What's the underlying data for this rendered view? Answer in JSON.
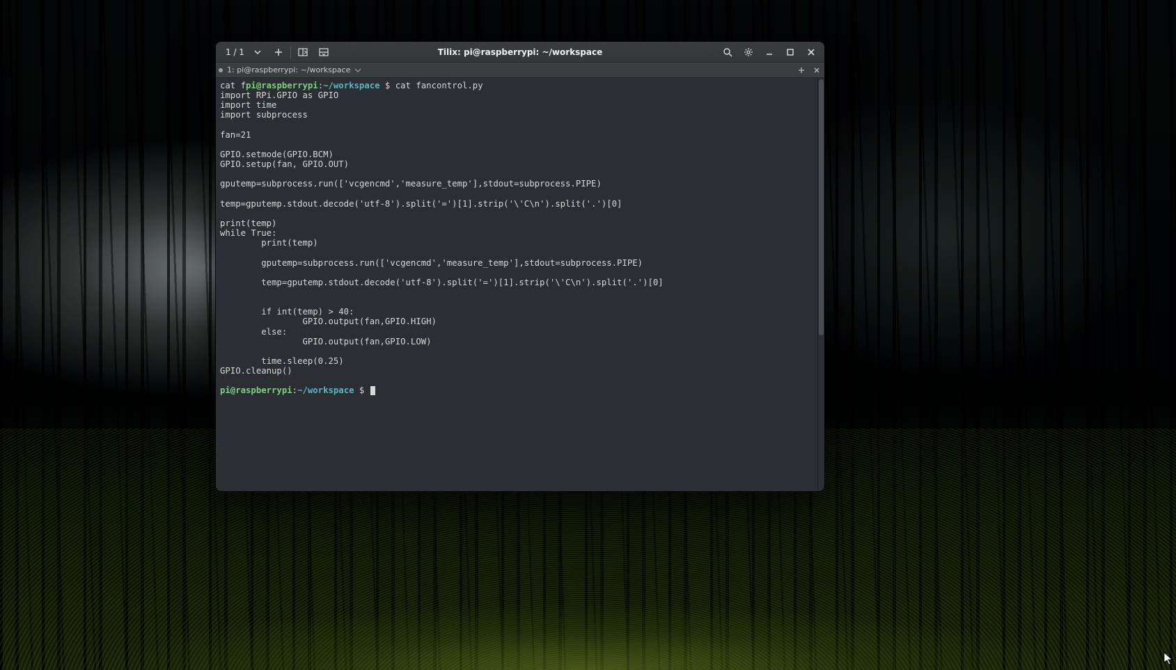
{
  "window": {
    "title": "Tilix: pi@raspberrypi: ~/workspace",
    "counter": "1 / 1"
  },
  "tab": {
    "label": "1: pi@raspberrypi: ~/workspace"
  },
  "prompt": {
    "user_host": "pi@raspberrypi",
    "sep": ":",
    "path": "~/workspace",
    "dollar": " $ "
  },
  "terminal": {
    "line0_prefix": "cat f",
    "line0_cmd": "cat fancontrol.py",
    "body": "import RPi.GPIO as GPIO\nimport time\nimport subprocess\n\nfan=21\n\nGPIO.setmode(GPIO.BCM)\nGPIO.setup(fan, GPIO.OUT)\n\ngputemp=subprocess.run(['vcgencmd','measure_temp'],stdout=subprocess.PIPE)\n\ntemp=gputemp.stdout.decode('utf-8').split('=')[1].strip('\\'C\\n').split('.')[0]\n\nprint(temp)\nwhile True:\n        print(temp)\n\n        gputemp=subprocess.run(['vcgencmd','measure_temp'],stdout=subprocess.PIPE)\n\n        temp=gputemp.stdout.decode('utf-8').split('=')[1].strip('\\'C\\n').split('.')[0]\n\n\n        if int(temp) > 40:\n                GPIO.output(fan,GPIO.HIGH)\n        else:\n                GPIO.output(fan,GPIO.LOW)\n\n        time.sleep(0.25)\nGPIO.cleanup()\n"
  }
}
